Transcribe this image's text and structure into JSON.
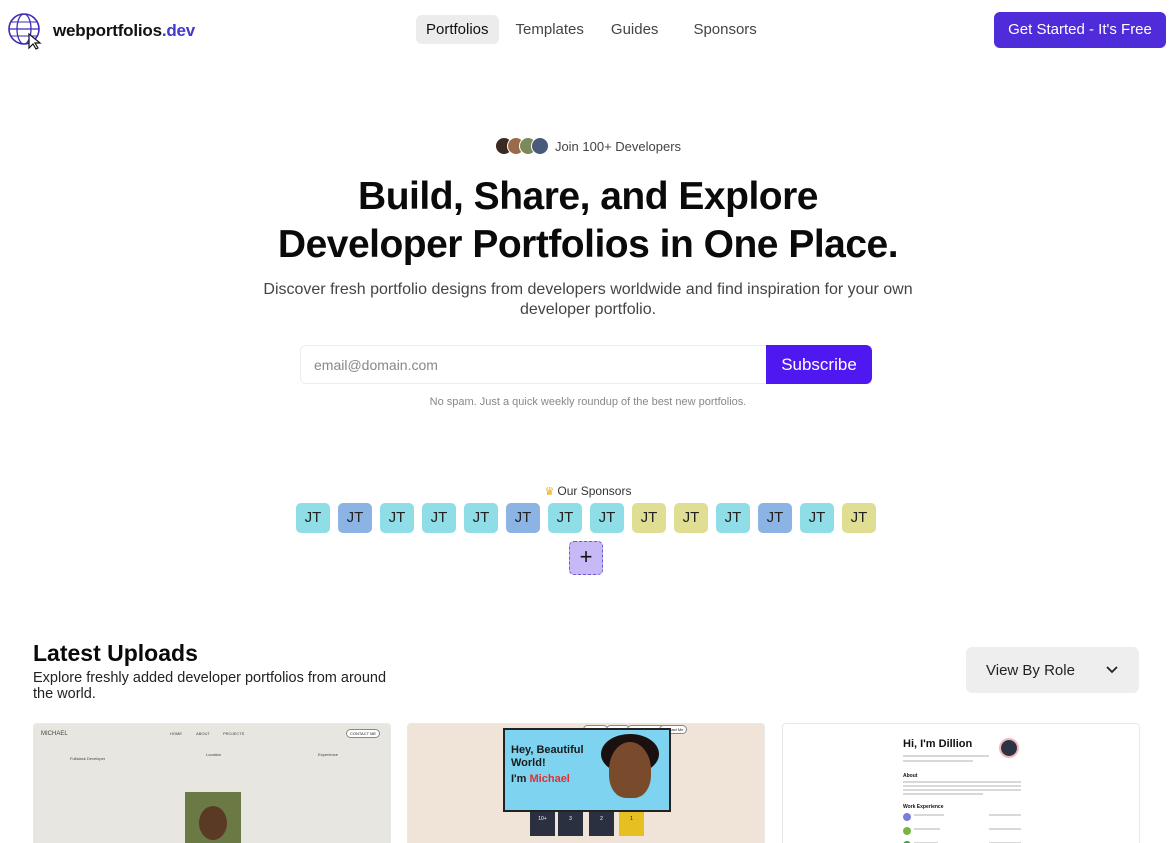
{
  "brand": {
    "name": "webportfolios",
    "tld": ".dev"
  },
  "nav": [
    {
      "label": "Portfolios",
      "active": true
    },
    {
      "label": "Templates",
      "active": false
    },
    {
      "label": "Guides",
      "active": false
    },
    {
      "label": "Sponsors",
      "active": false
    }
  ],
  "cta_label": "Get Started - It's Free",
  "hero": {
    "join_text": "Join 100+ Developers",
    "title_line1": "Build, Share, and Explore",
    "title_line2": "Developer Portfolios in One Place.",
    "subtitle": "Discover fresh portfolio designs from developers worldwide and find inspiration for your own developer portfolio.",
    "email_placeholder": "email@domain.com",
    "subscribe_label": "Subscribe",
    "no_spam": "No spam. Just a quick weekly roundup of the best new portfolios."
  },
  "sponsors": {
    "label": "Our Sponsors",
    "items": [
      {
        "initials": "JT",
        "color": "#8fdde6"
      },
      {
        "initials": "JT",
        "color": "#8bb3e3"
      },
      {
        "initials": "JT",
        "color": "#8fdde6"
      },
      {
        "initials": "JT",
        "color": "#8fdde6"
      },
      {
        "initials": "JT",
        "color": "#8fdde6"
      },
      {
        "initials": "JT",
        "color": "#8bb3e3"
      },
      {
        "initials": "JT",
        "color": "#8fdde6"
      },
      {
        "initials": "JT",
        "color": "#8fdde6"
      },
      {
        "initials": "JT",
        "color": "#e0de92"
      },
      {
        "initials": "JT",
        "color": "#e0de92"
      },
      {
        "initials": "JT",
        "color": "#8fdde6"
      },
      {
        "initials": "JT",
        "color": "#8bb3e3"
      },
      {
        "initials": "JT",
        "color": "#8fdde6"
      },
      {
        "initials": "JT",
        "color": "#e0de92"
      }
    ],
    "add_label": "+"
  },
  "latest": {
    "title": "Latest Uploads",
    "subtitle": "Explore freshly added developer portfolios from around the world.",
    "filter_label": "View By Role"
  },
  "cards": {
    "c1": {
      "name": "MICHAEL",
      "nav": [
        "HOME",
        "ABOUT",
        "PROJECTS"
      ],
      "contact": "CONTACT ME",
      "col1": "Fullstack Developer",
      "col2": "Location",
      "col3": "Experience"
    },
    "c2": {
      "pills": [
        "About Me",
        "My Skills",
        "My Previous Work",
        "Contact Me"
      ],
      "line1": "Hey, Beautiful",
      "line2": "World!",
      "line3": "I'm",
      "name": "Michael",
      "stats": [
        "10+",
        "3",
        "2",
        "1"
      ]
    },
    "c3": {
      "title": "Hi, I'm Dillion",
      "about": "About",
      "work": "Work Experience"
    }
  }
}
